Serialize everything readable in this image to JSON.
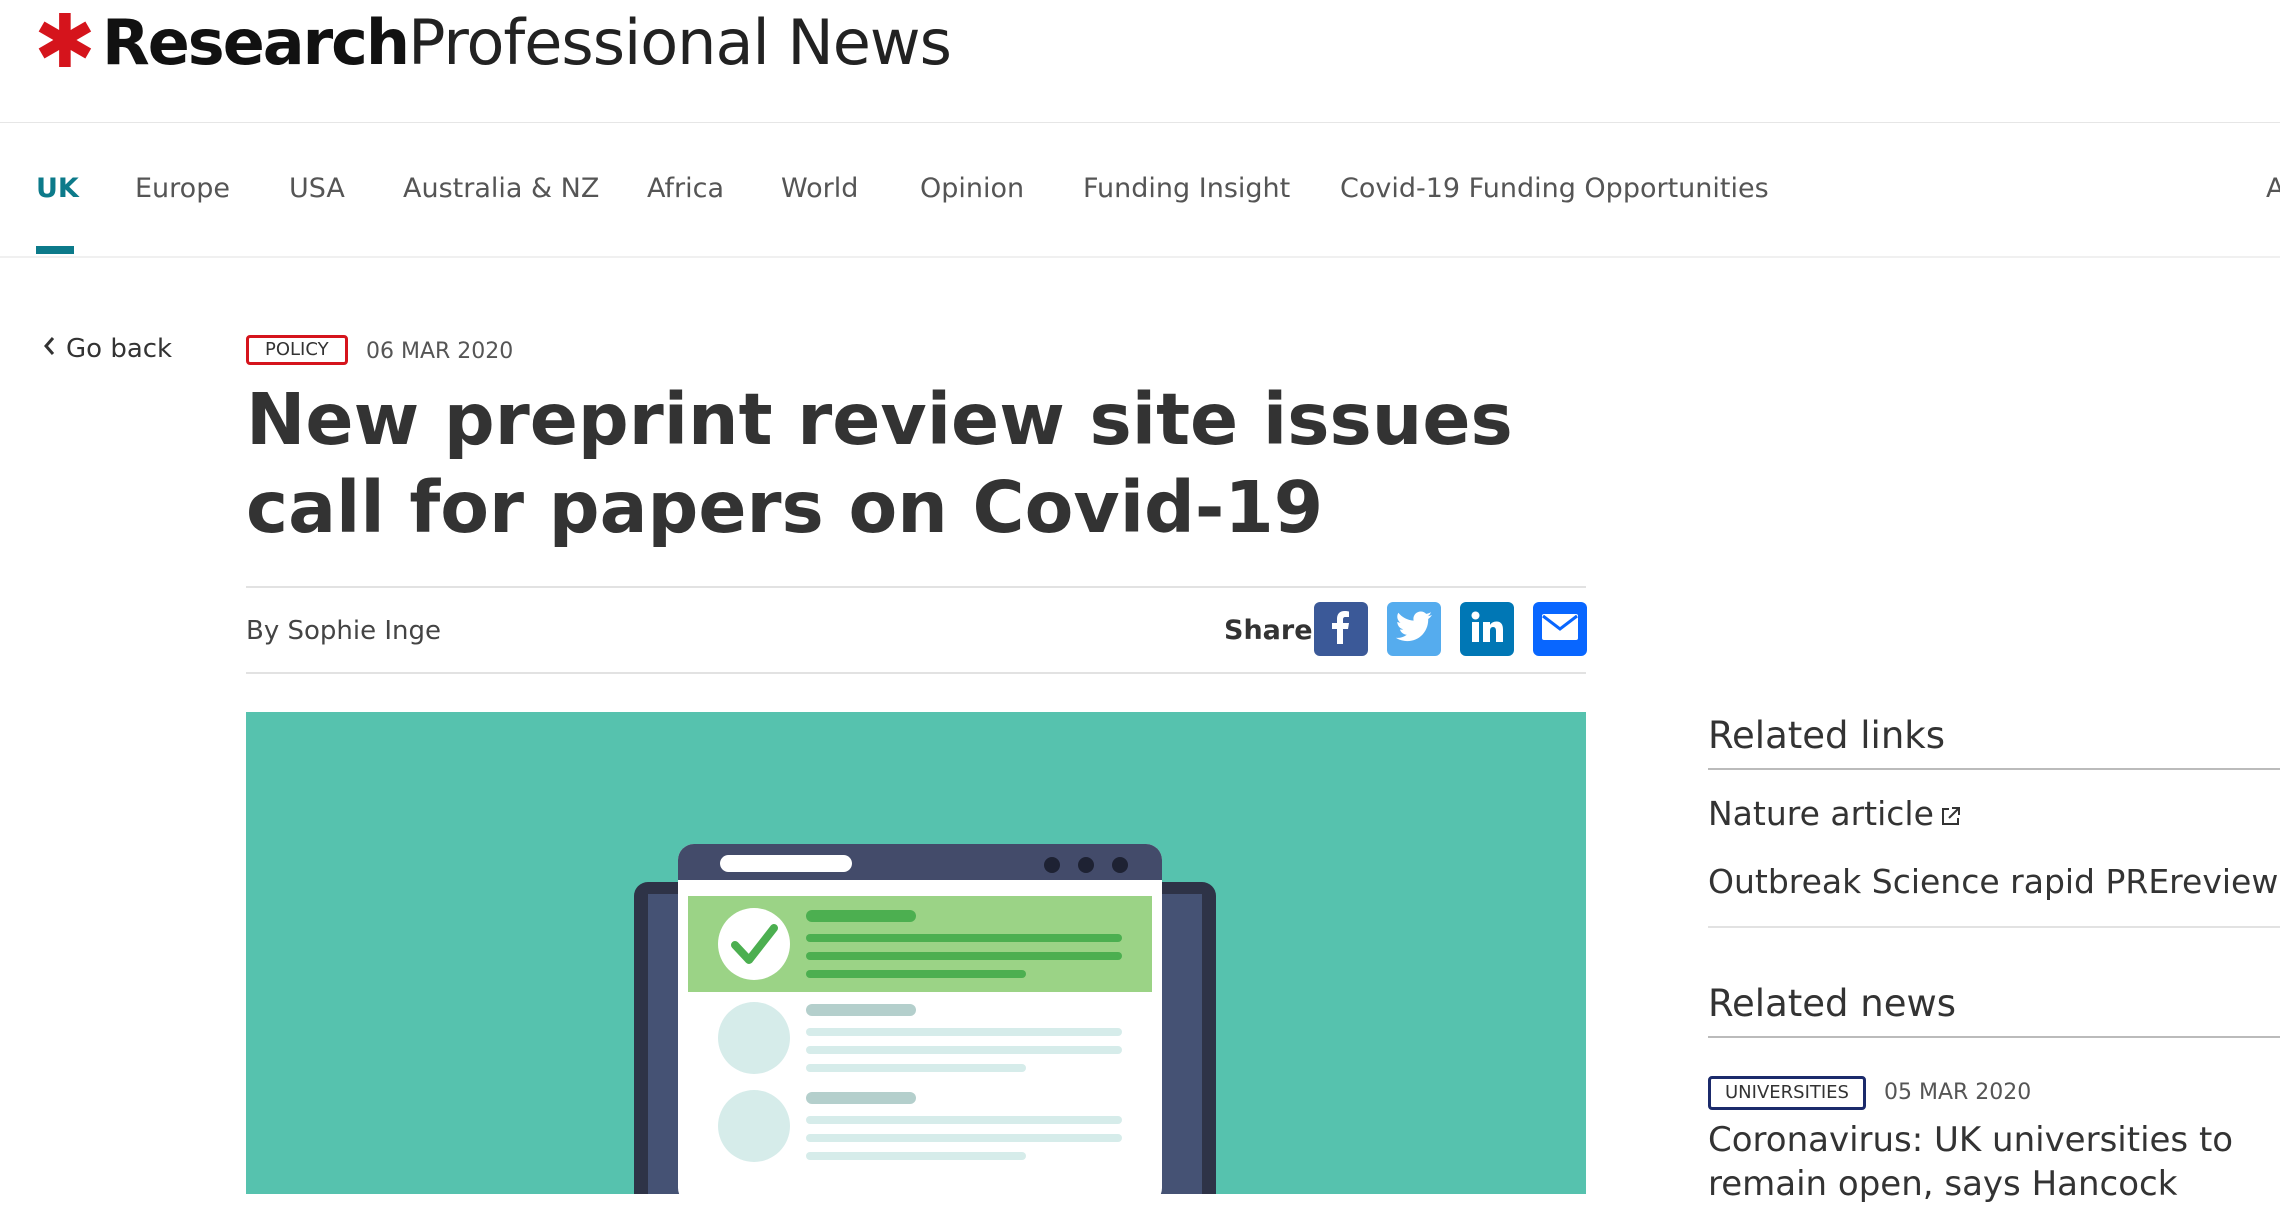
{
  "header": {
    "logo_star": "✱",
    "logo_bold": "Research",
    "logo_light": "Professional News"
  },
  "nav": {
    "items": [
      {
        "label": "UK",
        "active": true
      },
      {
        "label": "Europe"
      },
      {
        "label": "USA"
      },
      {
        "label": "Australia & NZ"
      },
      {
        "label": "Africa"
      },
      {
        "label": "World"
      },
      {
        "label": "Opinion"
      },
      {
        "label": "Funding Insight"
      },
      {
        "label": "Covid-19 Funding Opportunities"
      },
      {
        "label": "A"
      }
    ]
  },
  "go_back": {
    "label": "Go back",
    "icon": "chevron-left-icon"
  },
  "article": {
    "category": "POLICY",
    "date": "06 MAR 2020",
    "title": "New preprint review site issues call for papers on Covid-19",
    "byline": "By Sophie Inge",
    "share_label": "Share",
    "share_buttons": [
      {
        "name": "facebook-icon",
        "color": "#3b5998"
      },
      {
        "name": "twitter-icon",
        "color": "#55acee"
      },
      {
        "name": "linkedin-icon",
        "color": "#0077b5"
      },
      {
        "name": "email-icon",
        "color": "#0866ff"
      }
    ]
  },
  "sidebar": {
    "related_links_heading": "Related links",
    "related_links": [
      {
        "label": "Nature article",
        "icon": "external-link-icon"
      },
      {
        "label": "Outbreak Science rapid PREreview",
        "icon": "external-link-icon"
      }
    ],
    "related_news_heading": "Related news",
    "related_news": [
      {
        "category": "UNIVERSITIES",
        "date": "05 MAR 2020",
        "title": "Coronavirus: UK universities to remain open, says Hancock"
      }
    ]
  },
  "colors": {
    "accent": "#0c7a8a",
    "brand_red": "#d5141c",
    "hero_bg": "#56c2ae",
    "universities_badge": "#1b2a6b"
  }
}
